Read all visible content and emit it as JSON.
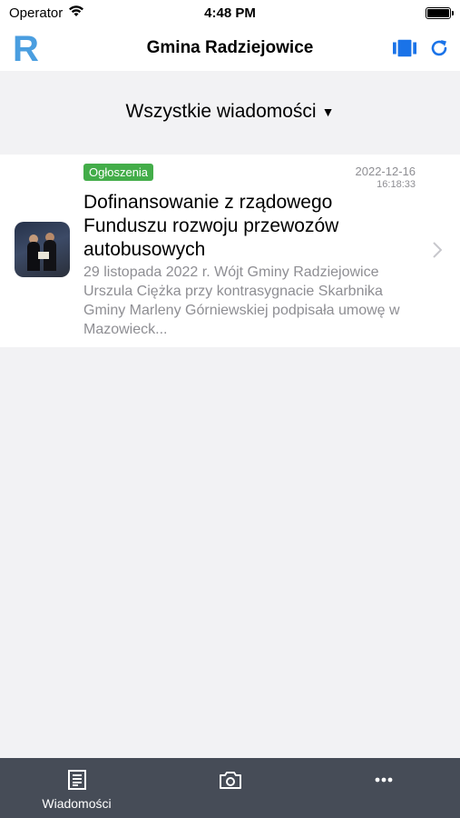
{
  "status_bar": {
    "carrier": "Operator",
    "time": "4:48 PM"
  },
  "nav": {
    "logo_letter": "R",
    "title": "Gmina Radziejowice",
    "icons": [
      "columns-icon",
      "refresh-icon"
    ]
  },
  "filter": {
    "label": "Wszystkie wiadomości",
    "caret": "▼"
  },
  "news": [
    {
      "category": "Ogłoszenia",
      "date": "2022-12-16",
      "time": "16:18:33",
      "title": "Dofinansowanie z rządowego Funduszu rozwoju przewozów autobusowych",
      "excerpt": "29 listopada 2022 r. Wójt Gminy Radziejowice Urszula Ciężka przy kontrasygnacie Skarbnika Gminy Marleny Górniewskiej podpisała umowę w Mazowieck..."
    }
  ],
  "colors": {
    "accent": "#1a73e8",
    "logo": "#4a9ee0",
    "badge": "#43ad49",
    "tab_bar": "#464c57"
  },
  "tabs": [
    {
      "label": "Wiadomości",
      "icon": "news-icon"
    },
    {
      "label": "",
      "icon": "camera-icon"
    },
    {
      "label": "",
      "icon": "more-icon"
    }
  ]
}
